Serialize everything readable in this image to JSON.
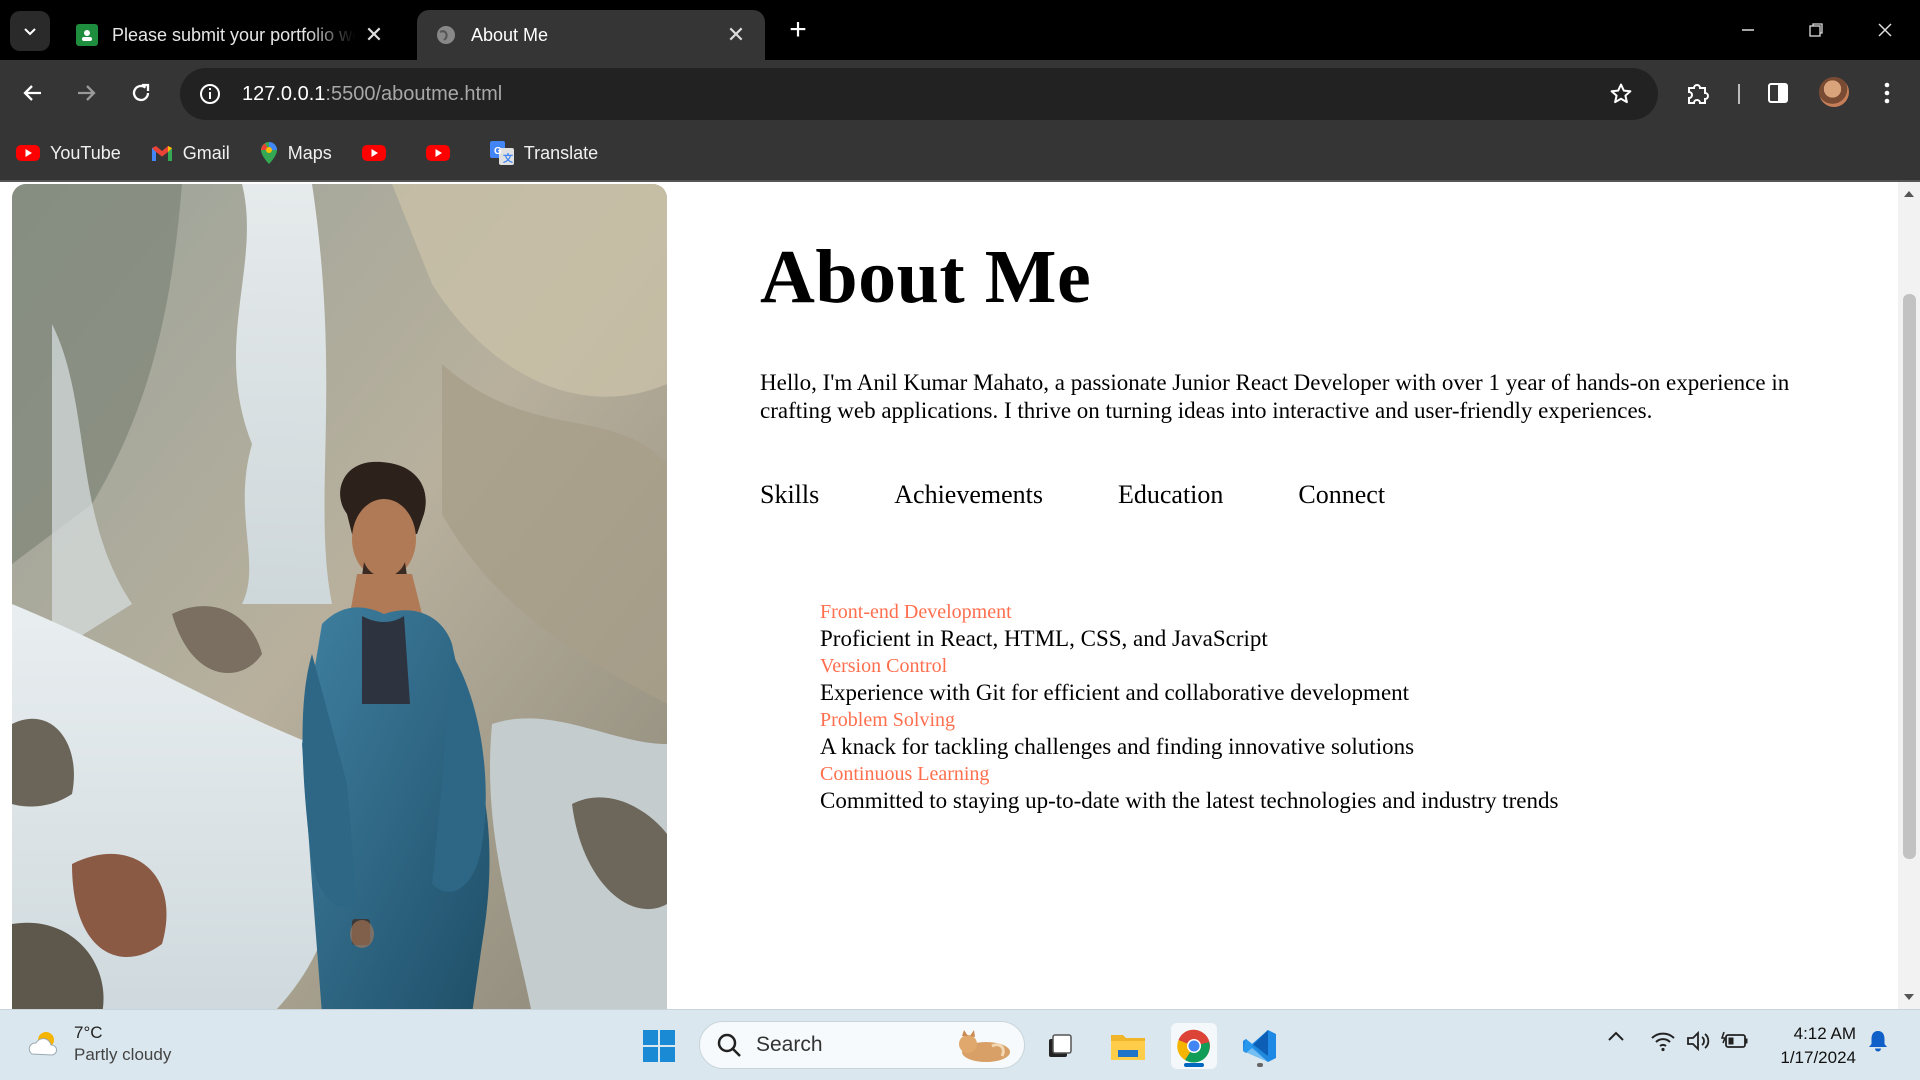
{
  "browser": {
    "tabs": [
      {
        "title": "Please submit your portfolio website",
        "favicon": "google-sheets-icon",
        "active": false
      },
      {
        "title": "About Me",
        "favicon": "globe-icon",
        "active": true
      }
    ],
    "url_host": "127.0.0.1",
    "url_path": ":5500/aboutme.html",
    "bookmarks": [
      {
        "label": "YouTube",
        "icon": "youtube-icon"
      },
      {
        "label": "Gmail",
        "icon": "gmail-icon"
      },
      {
        "label": "Maps",
        "icon": "maps-icon"
      },
      {
        "label": "",
        "icon": "youtube-icon"
      },
      {
        "label": "",
        "icon": "youtube-icon"
      },
      {
        "label": "Translate",
        "icon": "translate-icon"
      }
    ]
  },
  "page": {
    "heading": "About Me",
    "intro": "Hello, I'm Anil Kumar Mahato, a passionate Junior React Developer with over 1 year of hands-on experience in crafting web applications. I thrive on turning ideas into interactive and user-friendly experiences.",
    "tabs": [
      "Skills",
      "Achievements",
      "Education",
      "Connect"
    ],
    "skills": [
      {
        "title": "Front-end Development",
        "desc": "Proficient in React, HTML, CSS, and JavaScript"
      },
      {
        "title": "Version Control",
        "desc": "Experience with Git for efficient and collaborative development"
      },
      {
        "title": "Problem Solving",
        "desc": "A knack for tackling challenges and finding innovative solutions"
      },
      {
        "title": "Continuous Learning",
        "desc": "Committed to staying up-to-date with the latest technologies and industry trends"
      }
    ],
    "accent_color": "#ff6f4e"
  },
  "taskbar": {
    "weather_temp": "7°C",
    "weather_desc": "Partly cloudy",
    "search_label": "Search",
    "time": "4:12 AM",
    "date": "1/17/2024"
  }
}
